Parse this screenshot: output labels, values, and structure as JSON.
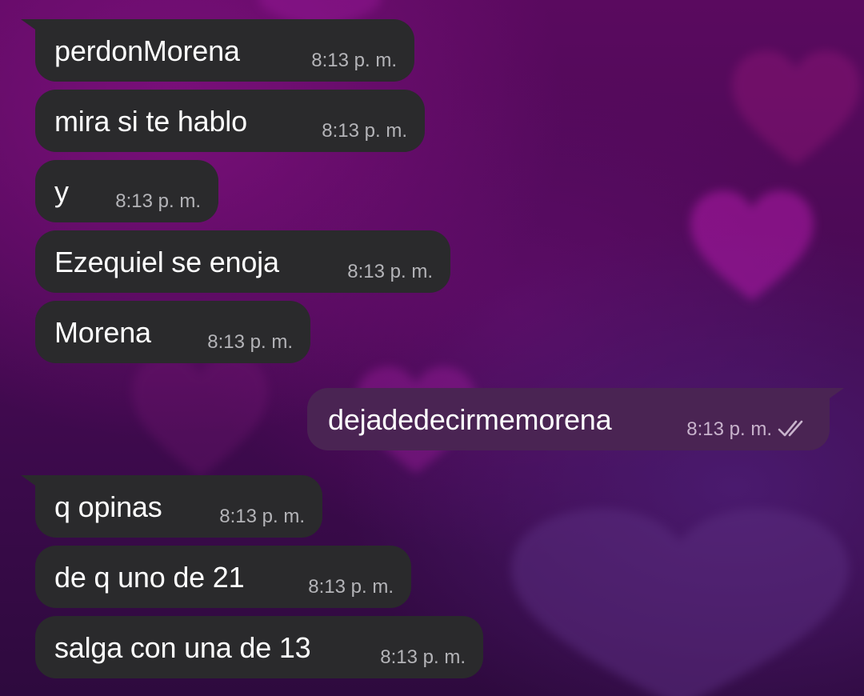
{
  "colors": {
    "incoming_bubble": "#2a2a2c",
    "outgoing_bubble": "#4a2453",
    "text": "#ffffff",
    "timestamp": "#b4b4b8",
    "wallpaper": "#4a0a55"
  },
  "wallpaper": {
    "icon": "heart-icon"
  },
  "messages": [
    {
      "direction": "incoming",
      "text": "perdonMorena",
      "time": "8:13 p. m."
    },
    {
      "direction": "incoming",
      "text": "mira si te hablo",
      "time": "8:13 p. m."
    },
    {
      "direction": "incoming",
      "text": "y",
      "time": "8:13 p. m."
    },
    {
      "direction": "incoming",
      "text": "Ezequiel se enoja",
      "time": "8:13 p. m."
    },
    {
      "direction": "incoming",
      "text": "Morena",
      "time": "8:13 p. m."
    },
    {
      "direction": "outgoing",
      "text": "dejadedecirmemorena",
      "time": "8:13 p. m.",
      "status_icon": "double-check-icon"
    },
    {
      "direction": "incoming",
      "text": "q opinas",
      "time": "8:13 p. m."
    },
    {
      "direction": "incoming",
      "text": "de q uno de 21",
      "time": "8:13 p. m."
    },
    {
      "direction": "incoming",
      "text": "salga con una de 13",
      "time": "8:13 p. m."
    }
  ]
}
